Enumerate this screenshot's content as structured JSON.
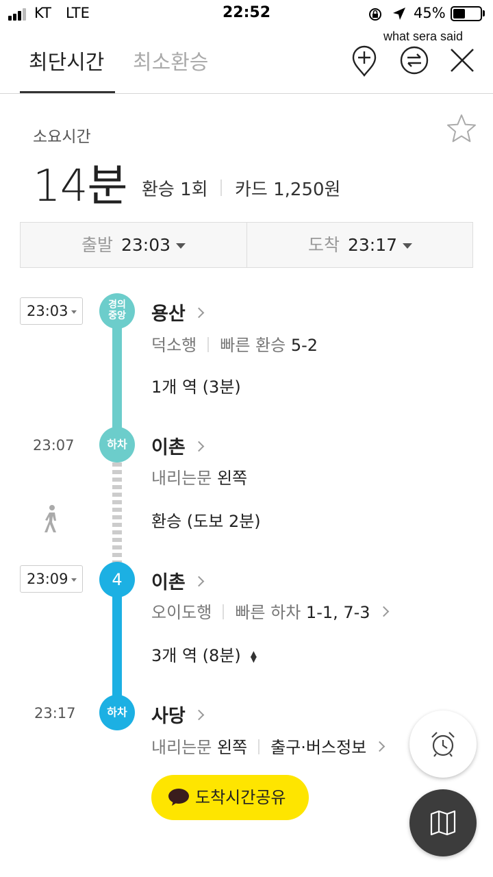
{
  "status_bar": {
    "carrier": "KT",
    "network": "LTE",
    "time": "22:52",
    "battery": "45%",
    "battery_level": 0.45
  },
  "caption": "what sera said",
  "tabs": [
    {
      "label": "최단시간",
      "active": true
    },
    {
      "label": "최소환승",
      "active": false
    }
  ],
  "header_icons": [
    "add-pin-icon",
    "swap-icon",
    "close-icon"
  ],
  "summary": {
    "duration_label": "소요시간",
    "duration": "14분",
    "transfers": "환승 1회",
    "fare": "카드 1,250원"
  },
  "time_select": {
    "depart_label": "출발",
    "depart_time": "23:03",
    "arrive_label": "도착",
    "arrive_time": "23:17"
  },
  "route": {
    "leg1": {
      "time": "23:03",
      "line_badge": [
        "경의",
        "중앙"
      ],
      "color": "#6ccdcb",
      "station": "용산",
      "direction": "덕소행",
      "fast_label": "빠른 환승",
      "fast_value": "5-2",
      "stops": "1개 역 (3분)"
    },
    "alight1": {
      "time": "23:07",
      "badge": "하차",
      "station": "이촌",
      "door_label": "내리는문",
      "door_value": "왼쪽"
    },
    "walk": {
      "text": "환승 (도보 2분)"
    },
    "leg2": {
      "time": "23:09",
      "line_badge": "4",
      "color": "#1cb0e3",
      "station": "이촌",
      "direction": "오이도행",
      "fast_label": "빠른 하차",
      "fast_value": "1-1, 7-3",
      "stops": "3개 역 (8분)"
    },
    "alight2": {
      "time": "23:17",
      "badge": "하차",
      "station": "사당",
      "door_label": "내리는문",
      "door_value": "왼쪽",
      "exit_info": "출구·버스정보"
    }
  },
  "share_button": "도착시간공유",
  "fabs": [
    "alarm-clock-icon",
    "map-icon"
  ]
}
